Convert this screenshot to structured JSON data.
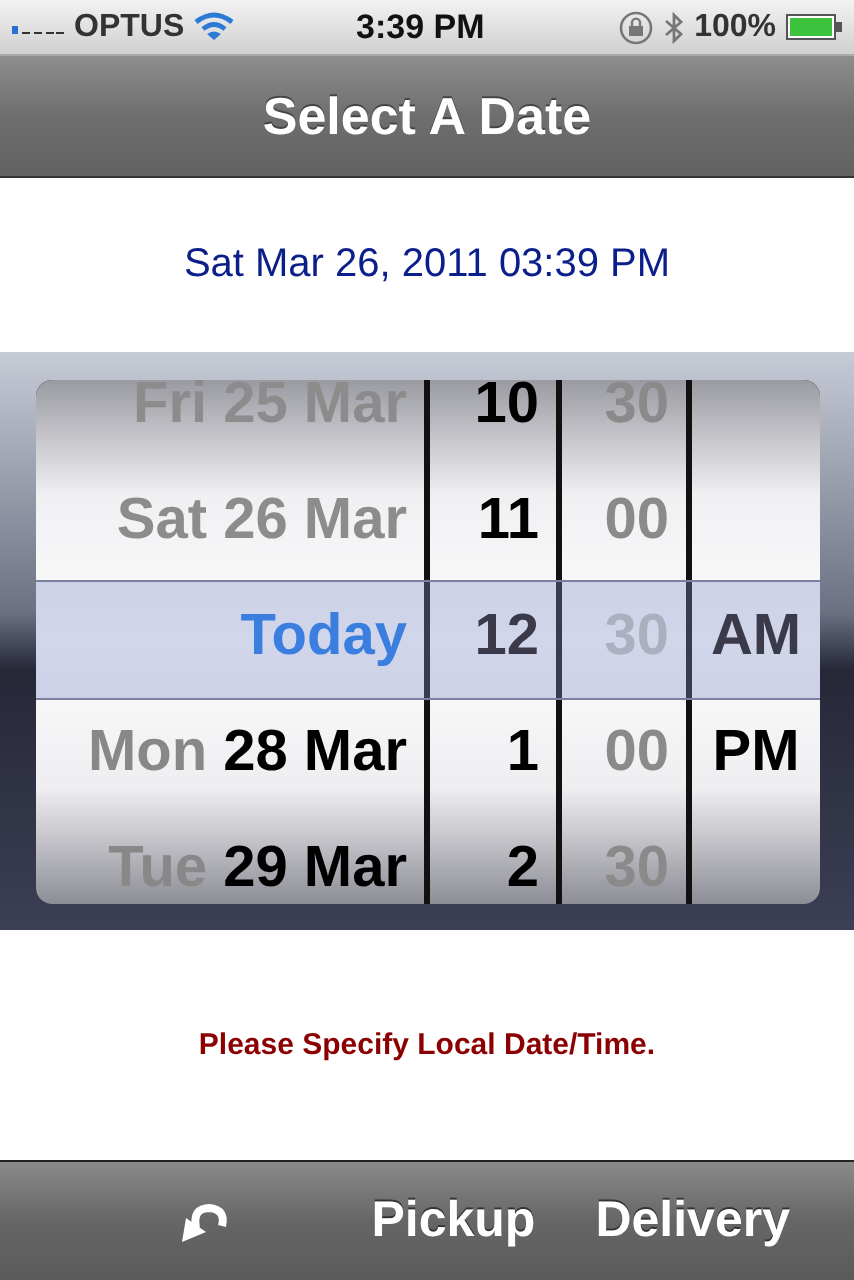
{
  "status_bar": {
    "carrier": "OPTUS",
    "time": "3:39 PM",
    "battery": "100%"
  },
  "nav_bar": {
    "title": "Select A Date"
  },
  "selected_date": "Sat Mar 26, 2011 03:39 PM",
  "picker": {
    "columns": [
      {
        "kind": "date",
        "dimmed": false,
        "rows": [
          {
            "weekday": "Fri",
            "date": "25 Mar",
            "past": true,
            "selected": false
          },
          {
            "weekday": "Sat",
            "date": "26 Mar",
            "past": true,
            "selected": false
          },
          {
            "date": "Today",
            "past": false,
            "selected": true
          },
          {
            "weekday": "Mon",
            "date": "28 Mar",
            "past": false,
            "selected": false
          },
          {
            "weekday": "Tue",
            "date": "29 Mar",
            "past": false,
            "selected": false
          }
        ]
      },
      {
        "kind": "hour",
        "dimmed": false,
        "rows": [
          {
            "text": "10",
            "selected": false
          },
          {
            "text": "11",
            "selected": false
          },
          {
            "text": "12",
            "selected": true
          },
          {
            "text": "1",
            "selected": false
          },
          {
            "text": "2",
            "selected": false
          }
        ]
      },
      {
        "kind": "minute",
        "dimmed": true,
        "rows": [
          {
            "text": "30",
            "selected": false
          },
          {
            "text": "00",
            "selected": false
          },
          {
            "text": "30",
            "selected": true
          },
          {
            "text": "00",
            "selected": false
          },
          {
            "text": "30",
            "selected": false
          }
        ]
      },
      {
        "kind": "ampm",
        "dimmed": false,
        "rows": [
          {
            "selected": false
          },
          {
            "selected": false
          },
          {
            "text": "AM",
            "selected": true
          },
          {
            "text": "PM",
            "selected": false
          },
          {
            "selected": false
          }
        ]
      }
    ]
  },
  "hint": "Please Specify Local Date/Time.",
  "toolbar": {
    "buttons": [
      {
        "kind": "undo"
      },
      {
        "kind": "text",
        "label": "Pickup"
      },
      {
        "kind": "text",
        "label": "Delivery"
      }
    ]
  }
}
